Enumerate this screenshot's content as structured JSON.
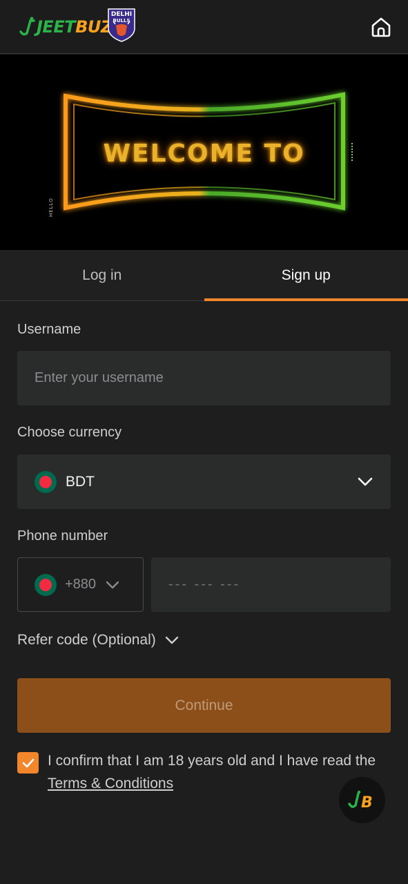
{
  "header": {
    "brand_part1": "JEET",
    "brand_part2": "BUZZ",
    "team_badge_line1": "DELHI",
    "team_badge_line2": "BULLS",
    "home_icon": "home-icon"
  },
  "banner": {
    "headline": "WELCOME TO",
    "side_text": "HELLO"
  },
  "tabs": [
    {
      "label": "Log in",
      "active": false
    },
    {
      "label": "Sign up",
      "active": true
    }
  ],
  "form": {
    "username": {
      "label": "Username",
      "placeholder": "Enter your username",
      "value": ""
    },
    "currency": {
      "label": "Choose currency",
      "value": "BDT",
      "flag_icon": "bangladesh-flag-icon"
    },
    "phone": {
      "label": "Phone number",
      "country_code": "+880",
      "placeholder": "--- --- ---",
      "value": ""
    },
    "refer_code": {
      "label": "Refer code (Optional)"
    },
    "continue_label": "Continue",
    "confirm": {
      "checked": true,
      "text": "I confirm that I am 18 years old and I have read the ",
      "link": "Terms & Conditions"
    }
  },
  "colors": {
    "accent": "#f2862a",
    "continue_bg": "#8c4f1a",
    "background": "#1e1e1e",
    "input_bg": "#2a2b2b",
    "brand_green": "#2bb34a",
    "brand_orange": "#f6a21e"
  },
  "fab": {
    "icon": "jeetbuzz-chat-icon"
  }
}
